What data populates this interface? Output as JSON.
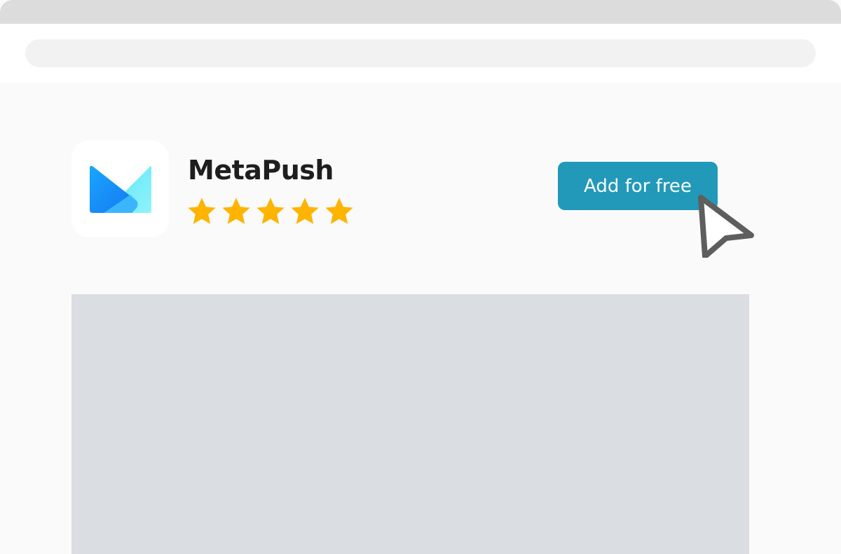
{
  "app": {
    "name": "MetaPush",
    "rating_stars": 5,
    "cta_label": "Add for free"
  },
  "colors": {
    "accent": "#2399b9",
    "star": "#ffb400",
    "logo_dark": "#1a8cf0",
    "logo_light": "#7ef0fa"
  },
  "icons": {
    "app_logo": "metapush-logo-icon",
    "rating": "star-icon",
    "pointer": "cursor-arrow-icon"
  }
}
